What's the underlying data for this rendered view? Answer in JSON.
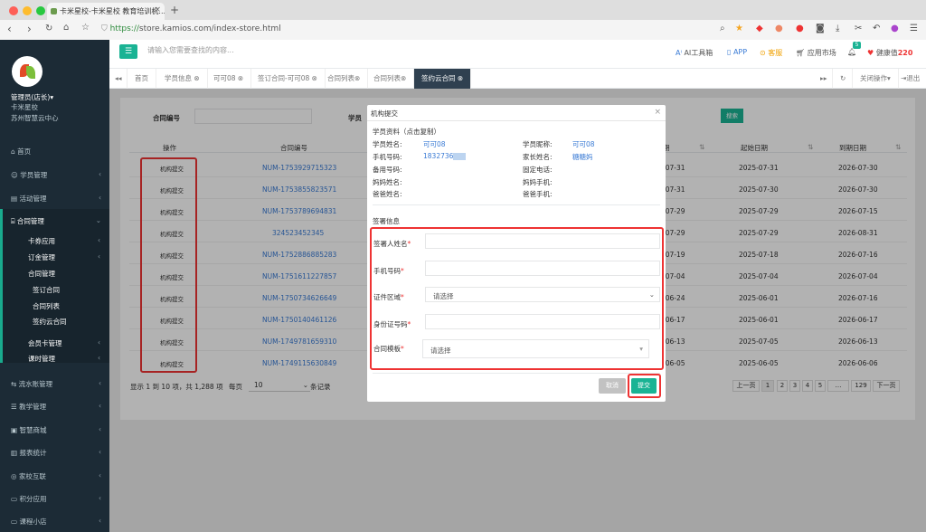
{
  "browser": {
    "tab_title": "卡米星校-卡米星校 教育培训机...",
    "url_scheme": "https://",
    "url_rest": "store.kamios.com/index-store.html"
  },
  "sidebar": {
    "user_name": "管理员(店长)",
    "org_name": "卡米星校",
    "campus": "苏州智慧云中心",
    "menu": [
      {
        "label": "首页"
      },
      {
        "label": "学员管理"
      },
      {
        "label": "活动管理"
      },
      {
        "label": "合同管理"
      }
    ],
    "contract_sub": [
      "卡券应用",
      "订金管理",
      "合同管理"
    ],
    "contract_sub2": [
      "签订合同",
      "合同列表",
      "签约云合同"
    ],
    "contract_sub3": [
      "会员卡管理",
      "课时管理"
    ],
    "menu_bottom": [
      {
        "label": "流水账管理"
      },
      {
        "label": "教学管理"
      },
      {
        "label": "智慧商城"
      },
      {
        "label": "报表统计"
      },
      {
        "label": "家校互联"
      },
      {
        "label": "积分应用"
      },
      {
        "label": "课程小店"
      }
    ]
  },
  "header": {
    "search_placeholder": "请输入您需要查找的内容...",
    "ai_tools": "AI工具箱",
    "app": "APP",
    "service": "客服",
    "market": "应用市场",
    "bell_count": "5",
    "health": "健康值",
    "health_value": "220"
  },
  "tabs": {
    "home": "首页",
    "items": [
      "学员信息",
      "可可08",
      "签订合同-可可08",
      "合同列表",
      "合同列表",
      "签约云合同"
    ],
    "close_ops": "关闭操作",
    "logout": "退出"
  },
  "content": {
    "filter_label": "合同编号",
    "student_label": "学员",
    "search_btn": "搜索",
    "columns": [
      "操作",
      "合同编号",
      "期",
      "起始日期",
      "到期日期"
    ],
    "op_label": "机构提交",
    "rows": [
      {
        "num": "NUM-1753929715323",
        "d1": "-07-31",
        "start": "2025-07-31",
        "end": "2026-07-30"
      },
      {
        "num": "NUM-1753855823571",
        "d1": "-07-31",
        "start": "2025-07-30",
        "end": "2026-07-30"
      },
      {
        "num": "NUM-1753789694831",
        "d1": "-07-29",
        "start": "2025-07-29",
        "end": "2026-07-15"
      },
      {
        "num": "324523452345",
        "d1": "-07-29",
        "start": "2025-07-29",
        "end": "2026-08-31"
      },
      {
        "num": "NUM-1752886885283",
        "d1": "-07-19",
        "start": "2025-07-18",
        "end": "2026-07-16"
      },
      {
        "num": "NUM-1751611227857",
        "d1": "-07-04",
        "start": "2025-07-04",
        "end": "2026-07-04"
      },
      {
        "num": "NUM-1750734626649",
        "d1": "-06-24",
        "start": "2025-06-01",
        "end": "2026-07-16"
      },
      {
        "num": "NUM-1750140461126",
        "d1": "-06-17",
        "start": "2025-06-01",
        "end": "2026-06-17"
      },
      {
        "num": "NUM-1749781659310",
        "d1": "-06-13",
        "start": "2025-07-05",
        "end": "2026-06-13"
      },
      {
        "num": "NUM-1749115630849",
        "d1": "-06-05",
        "start": "2025-06-05",
        "end": "2026-06-06"
      }
    ],
    "footer_info": "显示 1 到 10 项，共 1,288 项",
    "page_size_label": "每页",
    "page_size": "10",
    "page_size_suffix": "条记录",
    "pager": [
      "上一页",
      "1",
      "2",
      "3",
      "4",
      "5",
      "…",
      "129",
      "下一页"
    ]
  },
  "modal": {
    "title": "机构提交",
    "section1": "学员资料（点击复制）",
    "student_name_label": "学员姓名:",
    "student_name": "可可08",
    "nickname_label": "学员昵称:",
    "nickname": "可可08",
    "phone_label": "手机号码:",
    "phone": "1832736",
    "parent_label": "家长姓名:",
    "parent": "糖糖妈",
    "backup_label": "备用号码:",
    "landline_label": "固定电话:",
    "mother_label": "妈妈姓名:",
    "mother_phone_label": "妈妈手机:",
    "father_label": "爸爸姓名:",
    "father_phone_label": "爸爸手机:",
    "section2": "签署信息",
    "f_signer": "签署人姓名",
    "f_phone": "手机号码",
    "f_region": "证件区域",
    "f_region_value": "请选择",
    "f_id": "身份证号码",
    "f_template": "合同模板",
    "f_template_value": "请选择",
    "cancel": "取消",
    "submit": "提交"
  }
}
